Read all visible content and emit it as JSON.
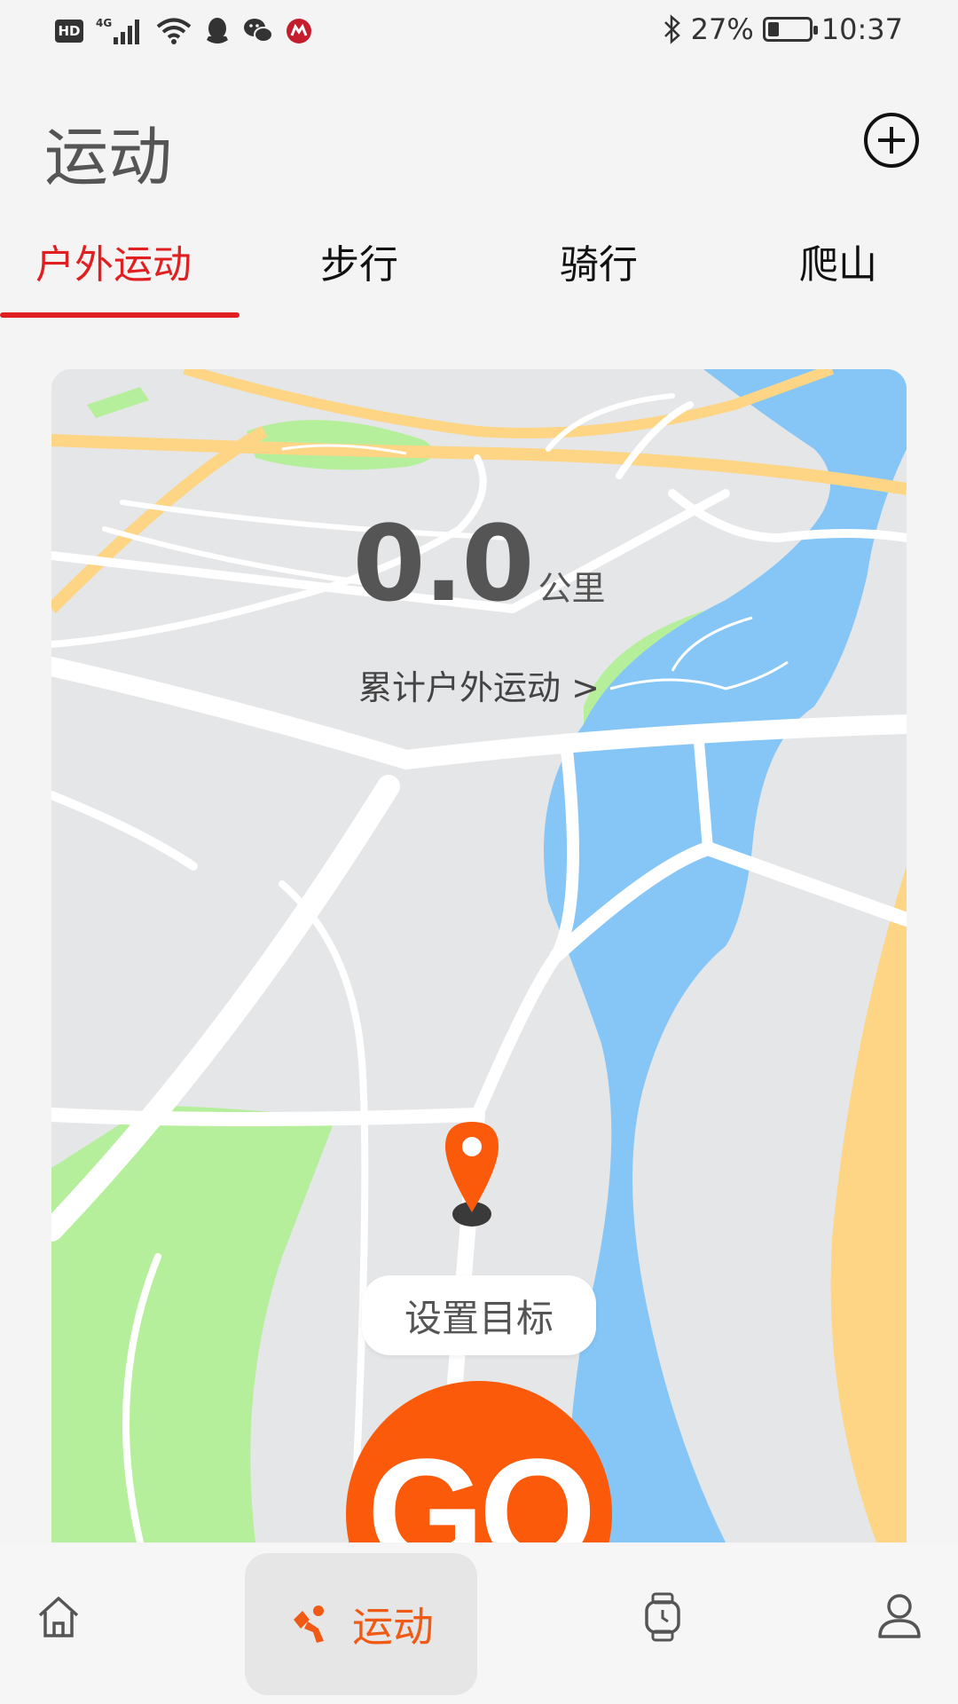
{
  "status_bar": {
    "network_badge": "HD",
    "network_type": "4G",
    "battery": "27%",
    "battery_level": 0.27,
    "time": "10:37",
    "icons": [
      "signal-icon",
      "wifi-icon",
      "qq-icon",
      "wechat-icon",
      "bank-icon",
      "bluetooth-icon",
      "battery-icon"
    ]
  },
  "header": {
    "title": "运动",
    "add_icon": "plus-circle-icon"
  },
  "tabs": [
    {
      "label": "户外运动",
      "active": true
    },
    {
      "label": "步行",
      "active": false
    },
    {
      "label": "骑行",
      "active": false
    },
    {
      "label": "爬山",
      "active": false
    }
  ],
  "map_card": {
    "distance_value": "0.0",
    "distance_unit": "公里",
    "cumulative_link": "累计户外运动 >",
    "location_icon": "location-pin-icon",
    "set_goal_label": "设置目标",
    "go_label": "GO"
  },
  "bottom_nav": [
    {
      "icon": "home-icon",
      "label": "",
      "active": false
    },
    {
      "icon": "running-icon",
      "label": "运动",
      "active": true
    },
    {
      "icon": "watch-icon",
      "label": "",
      "active": false
    },
    {
      "icon": "profile-icon",
      "label": "",
      "active": false
    }
  ],
  "colors": {
    "accent_red": "#e02020",
    "go_orange": "#fa5a0a",
    "river_blue": "#85c6f7",
    "park_green": "#b6ef9c",
    "road_yellow": "#fdd584"
  }
}
